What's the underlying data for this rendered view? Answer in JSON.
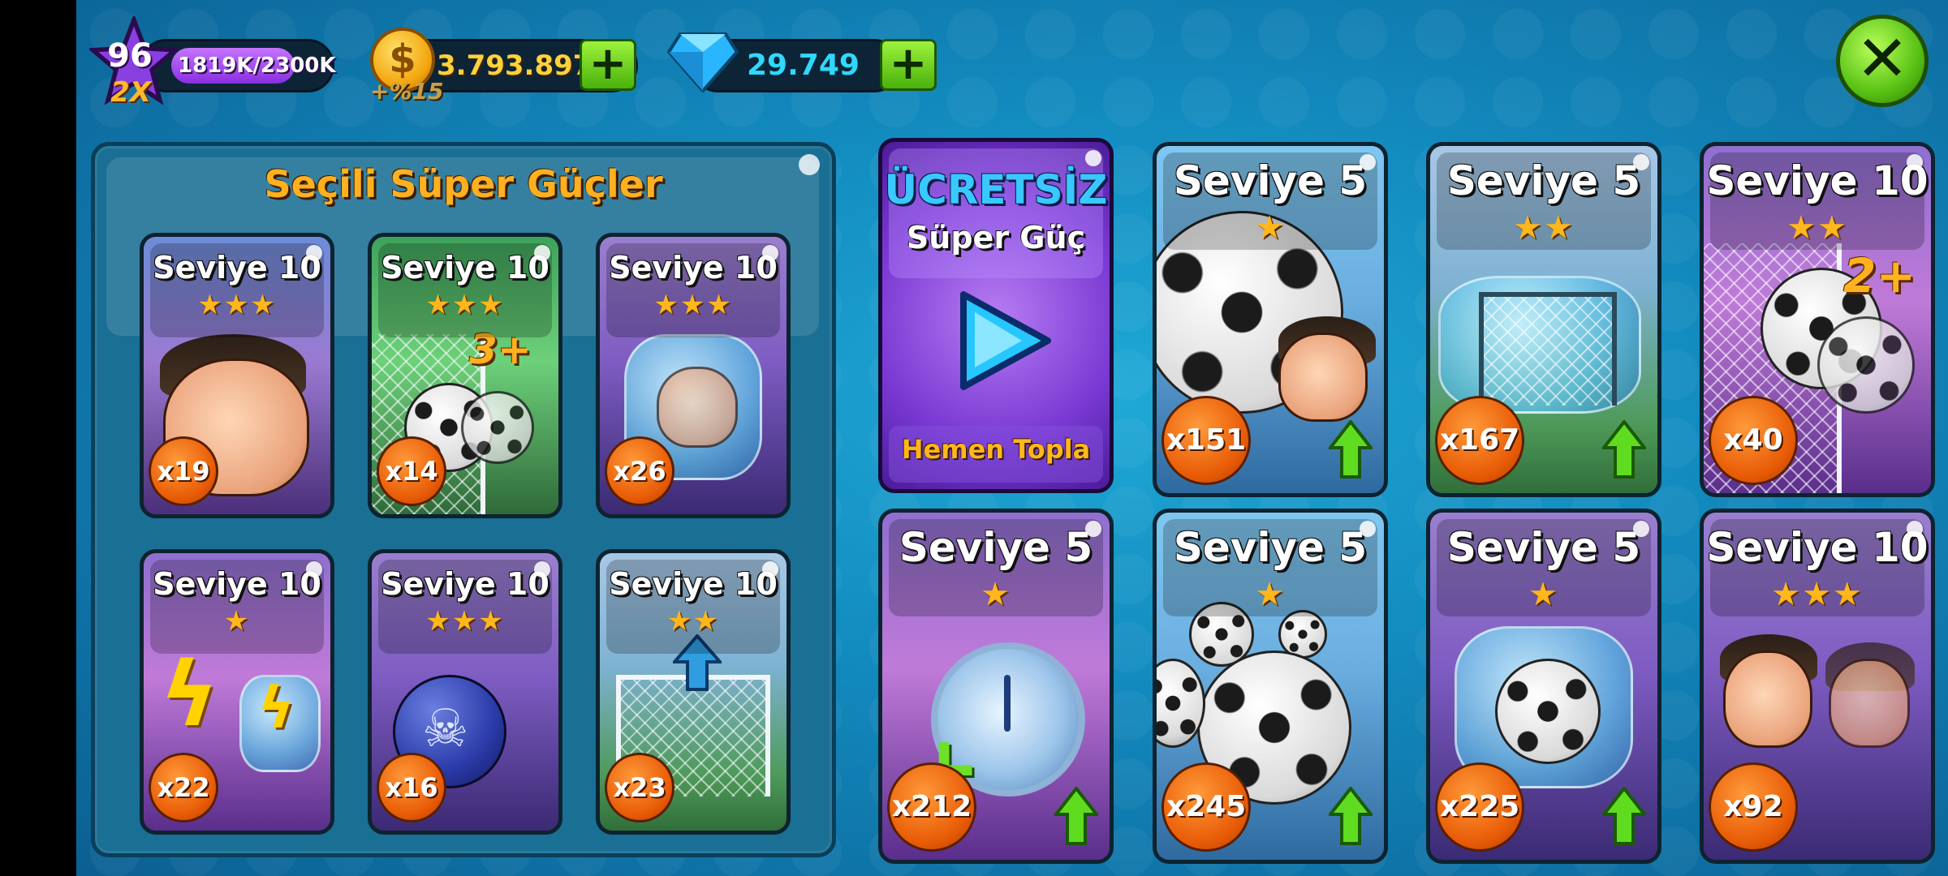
{
  "hud": {
    "level": "96",
    "level_multiplier": "2X",
    "xp": "1819K/2300K",
    "coins": "3.793.897",
    "coin_bonus": "+%15",
    "gems": "29.749",
    "plus": "+",
    "close": "✕"
  },
  "selected_panel": {
    "title": "Seçili Süper Güçler",
    "cards": [
      {
        "level": "Seviye 10",
        "stars": "★★★",
        "count": "x19",
        "icon": "angry-player-icon"
      },
      {
        "level": "Seviye 10",
        "stars": "★★★",
        "count": "x14",
        "icon": "triple-ball-icon",
        "badge": "3+"
      },
      {
        "level": "Seviye 10",
        "stars": "★★★",
        "count": "x26",
        "icon": "frozen-player-icon"
      },
      {
        "level": "Seviye 10",
        "stars": "★",
        "count": "x22",
        "icon": "lightning-icon"
      },
      {
        "level": "Seviye 10",
        "stars": "★★★",
        "count": "x16",
        "icon": "skull-bomb-icon"
      },
      {
        "level": "Seviye 10",
        "stars": "★★",
        "count": "x23",
        "icon": "big-goal-icon"
      }
    ]
  },
  "free_card": {
    "title": "ÜCRETSİZ",
    "subtitle": "Süper Güç",
    "action": "Hemen Topla"
  },
  "powerups": [
    {
      "level": "Seviye 5",
      "stars": "★",
      "count": "x151",
      "icon": "big-ball-player-icon",
      "upgrade": true
    },
    {
      "level": "Seviye 5",
      "stars": "★★",
      "count": "x167",
      "icon": "frozen-goal-icon",
      "upgrade": true
    },
    {
      "level": "Seviye 10",
      "stars": "★★",
      "count": "x40",
      "icon": "double-ball-icon",
      "badge": "2+",
      "upgrade": false
    },
    {
      "level": "Seviye 5",
      "stars": "★",
      "count": "x212",
      "icon": "time-plus-icon",
      "upgrade": true
    },
    {
      "level": "Seviye 5",
      "stars": "★",
      "count": "x245",
      "icon": "ball-rain-icon",
      "upgrade": true
    },
    {
      "level": "Seviye 5",
      "stars": "★",
      "count": "x225",
      "icon": "frozen-ball-icon",
      "upgrade": true
    },
    {
      "level": "Seviye 10",
      "stars": "★★★",
      "count": "x92",
      "icon": "speed-player-icon",
      "upgrade": false
    }
  ]
}
